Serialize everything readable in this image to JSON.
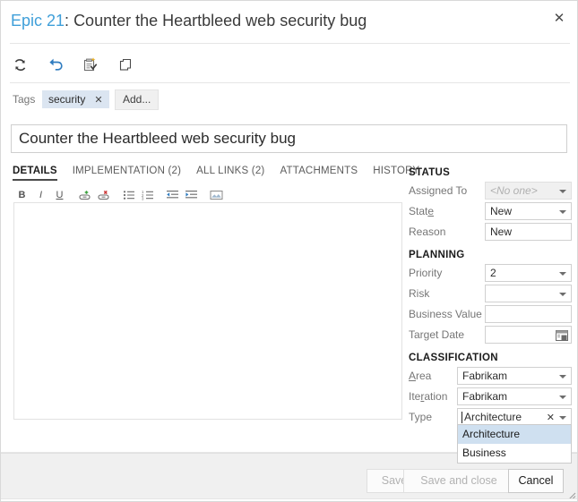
{
  "window": {
    "title_id": "Epic 21",
    "title_sep": ": ",
    "title_text": "Counter the Heartbleed web security bug",
    "close_label": "✕"
  },
  "toolbar": {
    "items": [
      {
        "name": "refresh-icon",
        "label": "Refresh"
      },
      {
        "name": "undo-icon",
        "label": "Undo"
      },
      {
        "name": "new-linked-work-item-icon",
        "label": "New linked work item"
      },
      {
        "name": "copy-icon",
        "label": "Copy"
      }
    ]
  },
  "tags": {
    "label": "Tags",
    "chips": [
      {
        "text": "security",
        "remove": "✕"
      }
    ],
    "add_label": "Add..."
  },
  "title_field": {
    "value": "Counter the Heartbleed web security bug"
  },
  "tabs": [
    {
      "label": "DETAILS",
      "active": true
    },
    {
      "label": "IMPLEMENTATION (2)",
      "active": false
    },
    {
      "label": "ALL LINKS (2)",
      "active": false
    },
    {
      "label": "ATTACHMENTS",
      "active": false
    },
    {
      "label": "HISTORY",
      "active": false
    }
  ],
  "editor_toolbar": [
    {
      "name": "bold-icon",
      "glyph": "B"
    },
    {
      "name": "italic-icon",
      "glyph": "I"
    },
    {
      "name": "underline-icon",
      "glyph": "U"
    },
    {
      "name": "insert-link-icon",
      "glyph": "⚭"
    },
    {
      "name": "remove-link-icon",
      "glyph": "⚭"
    },
    {
      "name": "bullet-list-icon",
      "glyph": "☰"
    },
    {
      "name": "numbered-list-icon",
      "glyph": "☰"
    },
    {
      "name": "outdent-icon",
      "glyph": "⇤"
    },
    {
      "name": "indent-icon",
      "glyph": "⇥"
    },
    {
      "name": "insert-image-icon",
      "glyph": "❑"
    }
  ],
  "description": {
    "value": "",
    "placeholder": ""
  },
  "panel": {
    "status": {
      "header": "STATUS",
      "fields": [
        {
          "label": "Assigned To",
          "value": "",
          "placeholder": "<No one>",
          "control": "dropdown",
          "disabled": true
        },
        {
          "label": "State",
          "value": "New",
          "control": "dropdown",
          "underline_index": 4
        },
        {
          "label": "Reason",
          "value": "New",
          "control": "text",
          "readonly": true
        }
      ]
    },
    "planning": {
      "header": "PLANNING",
      "fields": [
        {
          "label": "Priority",
          "value": "2",
          "control": "dropdown"
        },
        {
          "label": "Risk",
          "value": "",
          "control": "dropdown"
        },
        {
          "label": "Business Value",
          "value": "",
          "control": "text"
        },
        {
          "label": "Target Date",
          "value": "",
          "control": "date"
        }
      ]
    },
    "classification": {
      "header": "CLASSIFICATION",
      "fields": [
        {
          "label": "Area",
          "value": "Fabrikam",
          "control": "dropdown"
        },
        {
          "label": "Iteration",
          "value": "Fabrikam",
          "control": "dropdown"
        },
        {
          "label": "Type",
          "value": "Architecture",
          "control": "combobox",
          "clear": "✕",
          "focused": true
        }
      ]
    }
  },
  "type_dropdown": {
    "open": true,
    "options": [
      {
        "label": "Architecture",
        "selected": true
      },
      {
        "label": "Business",
        "selected": false
      }
    ]
  },
  "footer": {
    "save_label": "Save",
    "save_close_label": "Save and close",
    "cancel_label": "Cancel"
  },
  "colors": {
    "accent_blue": "#3f9fd9",
    "tag_chip_bg": "#dbe5f1",
    "dropdown_highlight": "#cfe0f0",
    "footer_bg": "#f0f0f0"
  }
}
